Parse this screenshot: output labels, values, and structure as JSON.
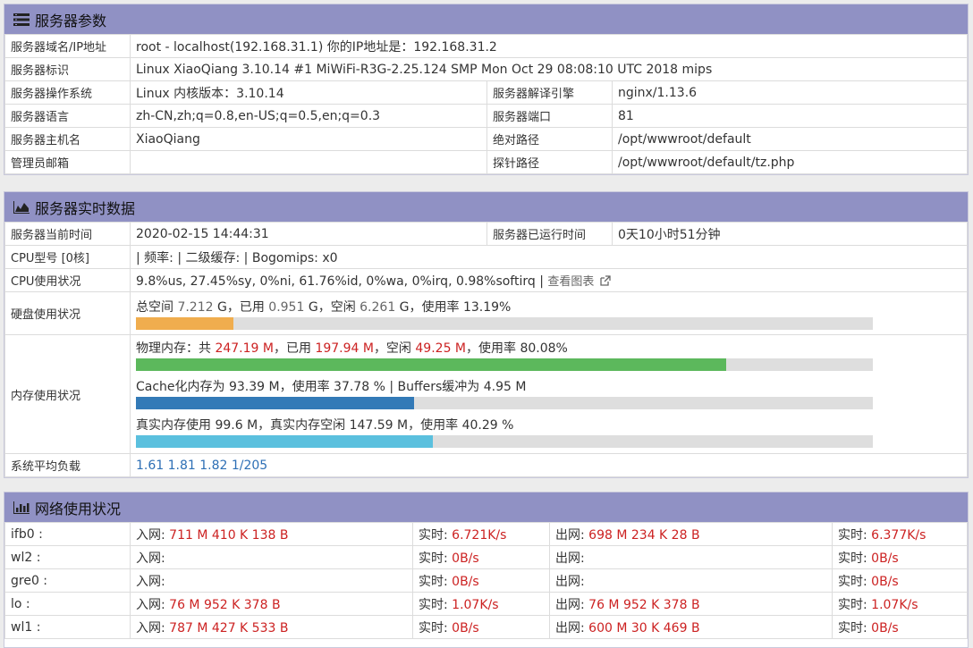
{
  "params": {
    "title": "服务器参数",
    "domain_label": "服务器域名/IP地址",
    "domain_value": "root - localhost(192.168.31.1)  你的IP地址是：192.168.31.2",
    "ident_label": "服务器标识",
    "ident_value": "Linux XiaoQiang 3.10.14 #1 MiWiFi-R3G-2.25.124 SMP Mon Oct 29 08:08:10 UTC 2018 mips",
    "os_label": "服务器操作系统",
    "os_value": "Linux  内核版本：3.10.14",
    "engine_label": "服务器解译引擎",
    "engine_value": "nginx/1.13.6",
    "lang_label": "服务器语言",
    "lang_value": "zh-CN,zh;q=0.8,en-US;q=0.5,en;q=0.3",
    "port_label": "服务器端口",
    "port_value": "81",
    "host_label": "服务器主机名",
    "host_value": "XiaoQiang",
    "abs_label": "绝对路径",
    "abs_value": "/opt/wwwroot/default",
    "admin_label": "管理员邮箱",
    "admin_value": "",
    "probe_label": "探针路径",
    "probe_value": "/opt/wwwroot/default/tz.php"
  },
  "realtime": {
    "title": "服务器实时数据",
    "time_label": "服务器当前时间",
    "time_value": "2020-02-15 14:44:31",
    "uptime_label": "服务器已运行时间",
    "uptime_value": "0天10小时51分钟",
    "cpu_model_label": "CPU型号 [0核]",
    "cpu_model_value": "| 频率: | 二级缓存: | Bogomips: x0",
    "cpu_usage_label": "CPU使用状况",
    "cpu_usage_value": "9.8%us, 27.45%sy, 0%ni, 61.76%id, 0%wa, 0%irq, 0.98%softirq",
    "cpu_sep": " | ",
    "cpu_chart_link": "查看图表",
    "disk_label": "硬盘使用状况",
    "disk": {
      "p1": "总空间 ",
      "total": "7.212",
      "p2": " G，已用 ",
      "used": "0.951",
      "p3": " G，空闲 ",
      "free": "6.261",
      "p4": " G，使用率 13.19%",
      "percent": 13.19,
      "color": "#f0ad4e"
    },
    "mem_label": "内存使用状况",
    "mem_phys": {
      "p1": "物理内存：共 ",
      "total": "247.19 M",
      "p2": "，已用 ",
      "used": "197.94 M",
      "p3": "，空闲 ",
      "free": "49.25 M",
      "p4": "，使用率 80.08%",
      "percent": 80.08,
      "color": "#5cb85c"
    },
    "mem_cache": {
      "text": "Cache化内存为 93.39 M，使用率 37.78 % | Buffers缓冲为 4.95 M",
      "percent": 37.78,
      "color": "#337ab7"
    },
    "mem_real": {
      "text": "真实内存使用 99.6 M，真实内存空闲 147.59 M，使用率 40.29 %",
      "percent": 40.29,
      "color": "#5bc0de"
    },
    "load_label": "系统平均负载",
    "load_value": "1.61 1.81 1.82 1/205"
  },
  "network": {
    "title": "网络使用状况",
    "in_label": "入网: ",
    "rt_label": "实时: ",
    "out_label": "出网: ",
    "rows": [
      {
        "iface": "ifb0 :",
        "in": "711 M 410 K 138 B",
        "in_rt": "6.721K/s",
        "out": "698 M 234 K 28 B",
        "out_rt": "6.377K/s"
      },
      {
        "iface": "wl2 :",
        "in": "",
        "in_rt": "0B/s",
        "out": "",
        "out_rt": "0B/s"
      },
      {
        "iface": "gre0 :",
        "in": "",
        "in_rt": "0B/s",
        "out": "",
        "out_rt": "0B/s"
      },
      {
        "iface": "lo :",
        "in": "76 M 952 K 378 B",
        "in_rt": "1.07K/s",
        "out": "76 M 952 K 378 B",
        "out_rt": "1.07K/s"
      },
      {
        "iface": "wl1 :",
        "in": "787 M 427 K 533 B",
        "in_rt": "0B/s",
        "out": "600 M 30 K 469 B",
        "out_rt": "0B/s"
      }
    ]
  }
}
